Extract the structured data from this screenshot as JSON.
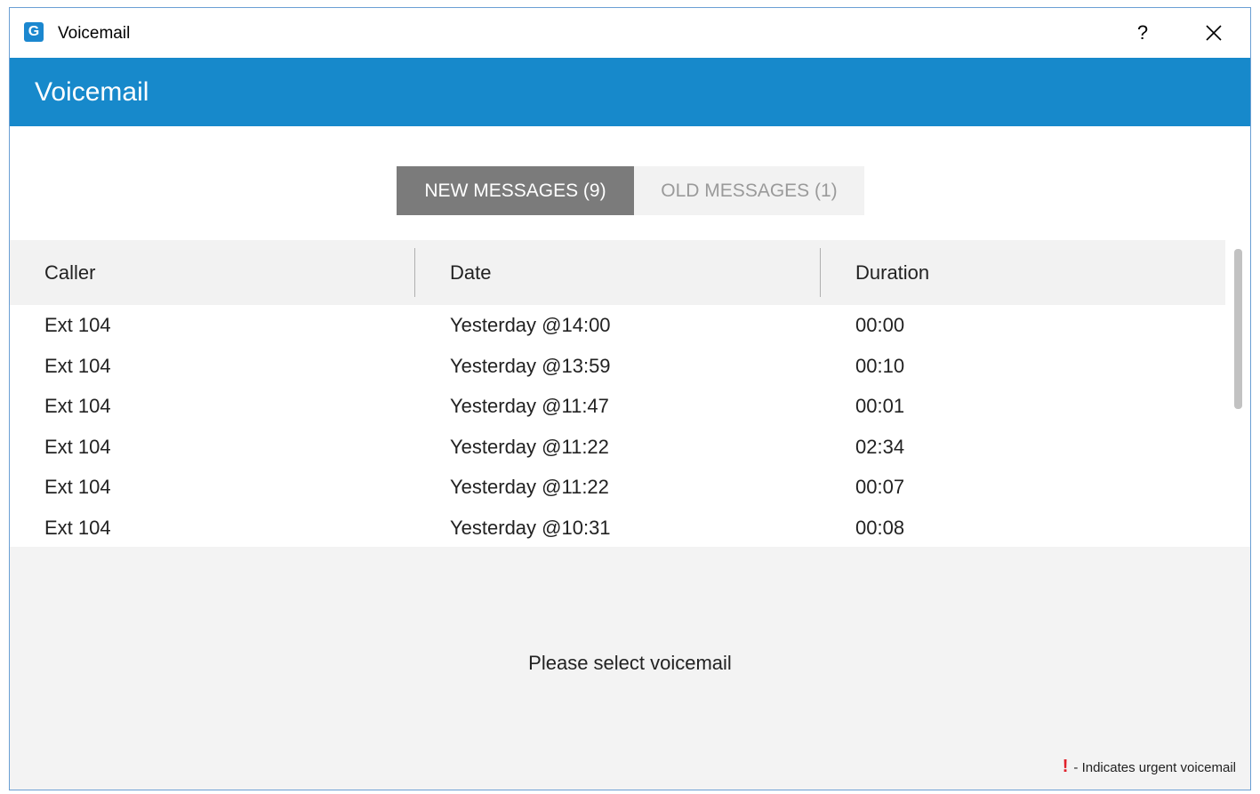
{
  "window": {
    "title": "Voicemail",
    "app_icon_letter": "G",
    "help_label": "?"
  },
  "header": {
    "title": "Voicemail"
  },
  "tabs": [
    {
      "label": "NEW MESSAGES (9)",
      "active": true
    },
    {
      "label": "OLD MESSAGES (1)",
      "active": false
    }
  ],
  "table": {
    "columns": [
      "Caller",
      "Date",
      "Duration"
    ],
    "rows": [
      {
        "caller": "Ext 104",
        "date": "Yesterday @14:00",
        "duration": "00:00"
      },
      {
        "caller": "Ext 104",
        "date": "Yesterday @13:59",
        "duration": "00:10"
      },
      {
        "caller": "Ext 104",
        "date": "Yesterday @11:47",
        "duration": "00:01"
      },
      {
        "caller": "Ext 104",
        "date": "Yesterday @11:22",
        "duration": "02:34"
      },
      {
        "caller": "Ext 104",
        "date": "Yesterday @11:22",
        "duration": "00:07"
      },
      {
        "caller": "Ext 104",
        "date": "Yesterday @10:31",
        "duration": "00:08"
      }
    ]
  },
  "detail": {
    "message": "Please select voicemail"
  },
  "legend": {
    "mark": "!",
    "text": "- Indicates urgent voicemail"
  },
  "colors": {
    "header_blue": "#1789cb",
    "active_tab": "#7b7b7b",
    "urgent": "#e0202a"
  }
}
